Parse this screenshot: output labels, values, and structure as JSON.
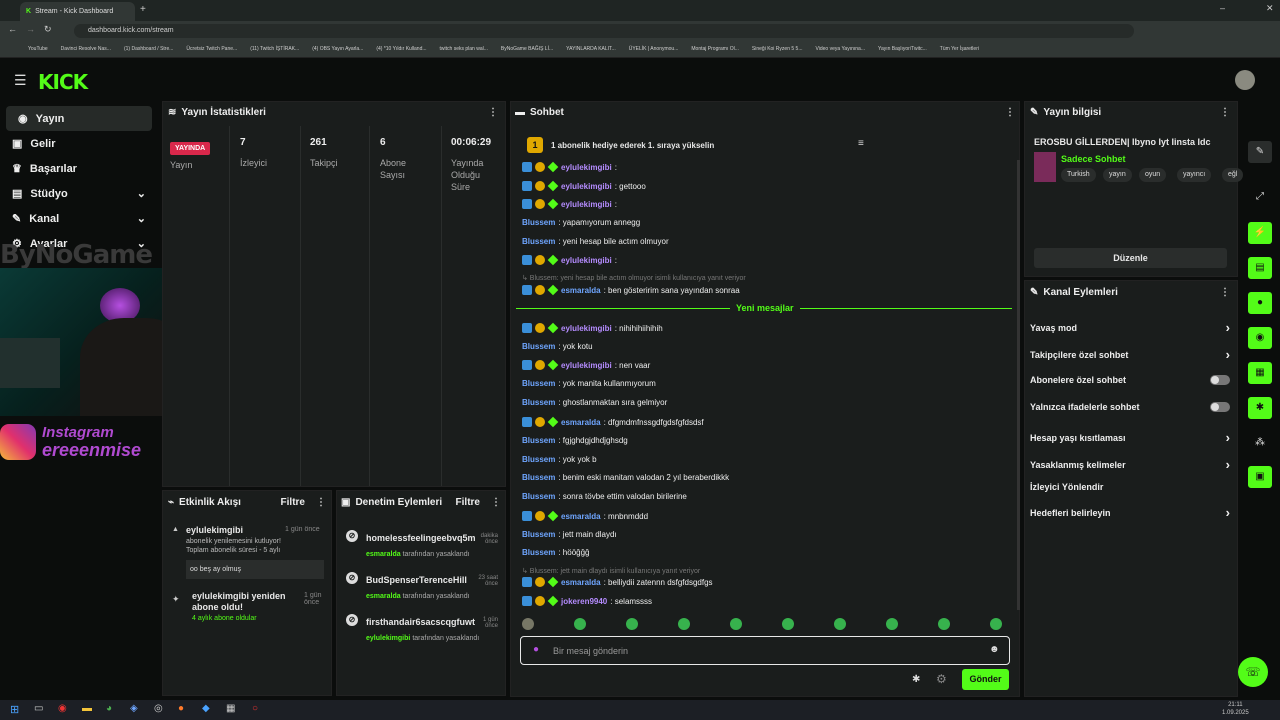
{
  "browser": {
    "tab_title": "Stream - Kick Dashboard",
    "url": "dashboard.kick.com/stream",
    "bookmarks": [
      "YouTube",
      "Davinci Resolve Nas...",
      "(1) Dashboard / Stre...",
      "Ücretsiz Twitch Pane...",
      "(11) Twitch İŞTİRAK...",
      "(4) OBS Yayın Ayarla...",
      "(4) *10 Yıldır Kulland...",
      "twitch seks plan wal...",
      "ByNoGame BAĞIŞ Lİ...",
      "YAYINLARDA KALIT...",
      "ÜYELİK | Anonymou...",
      "Montaj Programı Ol...",
      "Sineği Koi Ryzen 5 5...",
      "Video veya Yayınına...",
      "Yayın Başlıyor/Twitc...",
      "Tüm Yer İşaretleri"
    ]
  },
  "brand": "KICK",
  "sidebar": [
    "Yayın",
    "Gelir",
    "Başarılar",
    "Stüdyo",
    "Kanal",
    "Ayarlar"
  ],
  "overlay": {
    "bynogame": "ByNoGame",
    "instagram": "Instagram",
    "handle": "ereeenmise"
  },
  "stats": {
    "title": "Yayın İstatistikleri",
    "live": "YAYINDA",
    "live_label": "Yayın",
    "items": [
      {
        "n": "7",
        "l": "İzleyici"
      },
      {
        "n": "261",
        "l": "Takipçi"
      },
      {
        "n": "6",
        "l": "Abone Sayısı"
      },
      {
        "n": "00:06:29",
        "l": "Yayında Olduğu Süre"
      }
    ]
  },
  "activity": {
    "title": "Etkinlik Akışı",
    "filter": "Filtre",
    "e1": {
      "user": "eylulekimgibi",
      "time": "1 gün önce",
      "l1": "abonelik yenilemesini kutluyor!",
      "l2": "Toplam abonelik süresi - 5 aylı",
      "quote": "oo beş ay olmuş"
    },
    "e2": {
      "title": "eylulekimgibi yeniden abone oldu!",
      "time": "1 gün önce",
      "sub": "4 aylık abone oldular"
    }
  },
  "mod": {
    "title": "Denetim Eylemleri",
    "filter": "Filtre",
    "items": [
      {
        "name": "homelessfeelingeebvq5m",
        "time": "dakika önce",
        "by": "esmaralda",
        "action": "tarafından yasaklandı"
      },
      {
        "name": "BudSpenserTerenceHill",
        "time": "23 saat önce",
        "by": "esmaralda",
        "action": "tarafından yasaklandı"
      },
      {
        "name": "firsthandair6sacscqgfuwt",
        "time": "1 gün önce",
        "by": "eylulekimgibi",
        "action": "tarafından yasaklandı"
      }
    ]
  },
  "chat": {
    "title": "Sohbet",
    "pinned": "1 abonelik hediye ederek 1. sıraya yükselin",
    "new_msgs": "Yeni mesajlar",
    "input_placeholder": "Bir mesaj gönderin",
    "send": "Gönder",
    "messages": [
      {
        "u": "eylulekimgibi",
        "c": "purple",
        "t": ":",
        "b": true
      },
      {
        "u": "eylulekimgibi",
        "c": "purple",
        "t": ": gettooo",
        "b": true
      },
      {
        "u": "eylulekimgibi",
        "c": "purple",
        "t": ":",
        "b": true
      },
      {
        "u": "Blussem",
        "c": "blue",
        "t": ": yapamıyorum annegg",
        "b": false
      },
      {
        "u": "Blussem",
        "c": "blue",
        "t": ": yeni hesap bile actım olmuyor",
        "b": false
      },
      {
        "u": "eylulekimgibi",
        "c": "purple",
        "t": ":",
        "b": true
      },
      {
        "u": "esmaralda",
        "c": "blue",
        "t": ": ben gösteririm sana yayından sonraa",
        "b": true
      },
      {
        "u": "eylulekimgibi",
        "c": "purple",
        "t": ": nihihihiihihih",
        "b": true
      },
      {
        "u": "Blussem",
        "c": "blue",
        "t": ": yok kotu",
        "b": false
      },
      {
        "u": "eylulekimgibi",
        "c": "purple",
        "t": ": nen vaar",
        "b": true
      },
      {
        "u": "Blussem",
        "c": "blue",
        "t": ": yok manita kullanmıyorum",
        "b": false
      },
      {
        "u": "Blussem",
        "c": "blue",
        "t": ": ghostlanmaktan sıra gelmiyor",
        "b": false
      },
      {
        "u": "esmaralda",
        "c": "blue",
        "t": ": dfgmdmfnssgdfgdsfgfdsdsf",
        "b": true
      },
      {
        "u": "Blussem",
        "c": "blue",
        "t": ": fgjghdgjdhdjghsdg",
        "b": false
      },
      {
        "u": "Blussem",
        "c": "blue",
        "t": ": yok yok b",
        "b": false
      },
      {
        "u": "Blussem",
        "c": "blue",
        "t": ": benim eski manitam valodan 2 yıl beraberdikkk",
        "b": false
      },
      {
        "u": "Blussem",
        "c": "blue",
        "t": ": sonra tövbe ettim valodan birilerine",
        "b": false
      },
      {
        "u": "esmaralda",
        "c": "blue",
        "t": ": mnbnmddd",
        "b": true
      },
      {
        "u": "Blussem",
        "c": "blue",
        "t": ": jett main dlaydı",
        "b": false
      },
      {
        "u": "Blussem",
        "c": "blue",
        "t": ": hööğğğ",
        "b": false
      },
      {
        "u": "esmaralda",
        "c": "blue",
        "t": ": belliydii zatennn dsfgfdsgdfgs",
        "b": true
      },
      {
        "u": "jokeren9940",
        "c": "purple",
        "t": ": selamssss",
        "b": true
      }
    ],
    "reply1": "↳ Blussem: yeni hesap bile actım olmuyor isimli kullanıcıya yanıt veriyor",
    "reply2": "↳ Blussem: jett main dlaydı isimli kullanıcıya yanıt veriyor"
  },
  "info": {
    "title": "Yayın bilgisi",
    "stream_title": "EROSBU GİLLERDEN| Ibyno Iyt Iinsta Idc",
    "category": "Sadece Sohbet",
    "tags": [
      "Turkish",
      "yayın",
      "oyun",
      "yayıncı",
      "eğl"
    ],
    "edit": "Düzenle"
  },
  "actions": {
    "title": "Kanal Eylemleri",
    "items": [
      "Yavaş mod",
      "Takipçilere özel sohbet",
      "Abonelere özel sohbet",
      "Yalnızca ifadelerle sohbet",
      "Hesap yaşı kısıtlaması",
      "Yasaklanmış kelimeler",
      "İzleyici Yönlendir",
      "Hedefleri belirleyin"
    ]
  },
  "taskbar": {
    "time": "21:11",
    "date": "1.09.2025"
  }
}
